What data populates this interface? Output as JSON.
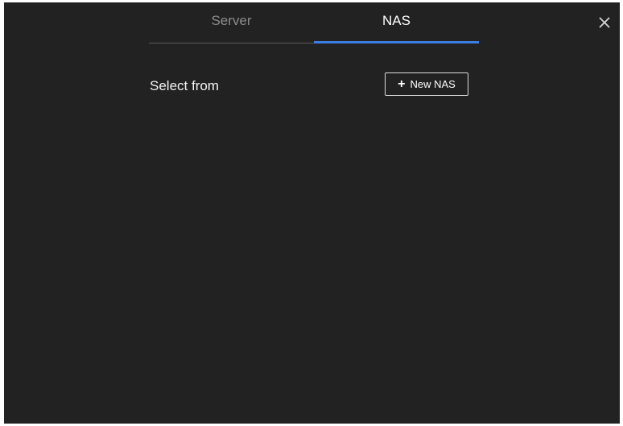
{
  "tabs": [
    {
      "label": "Server",
      "active": false
    },
    {
      "label": "NAS",
      "active": true
    }
  ],
  "close_icon": "close-icon",
  "select_label": "Select from",
  "new_nas_button": {
    "icon": "plus-icon",
    "label": "New NAS"
  },
  "colors": {
    "background": "#222222",
    "accent": "#3b7de0",
    "text": "#f2f2f2",
    "inactive_text": "#8c8c8c"
  }
}
